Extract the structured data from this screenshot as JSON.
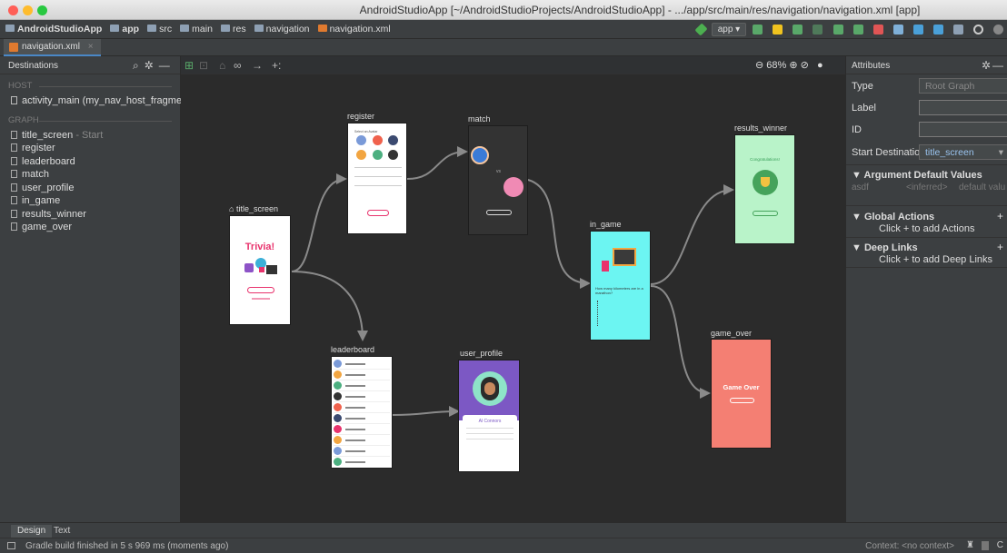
{
  "window": {
    "title": "AndroidStudioApp [~/AndroidStudioProjects/AndroidStudioApp] - .../app/src/main/res/navigation/navigation.xml [app]"
  },
  "breadcrumb": [
    "AndroidStudioApp",
    "app",
    "src",
    "main",
    "res",
    "navigation",
    "navigation.xml"
  ],
  "toolbar": {
    "run_config": "app ▾"
  },
  "editor_tab": {
    "label": "navigation.xml",
    "close": "×"
  },
  "destinations_panel": {
    "title": "Destinations",
    "host_label": "HOST",
    "host_item": "activity_main (my_nav_host_fragment)",
    "graph_label": "GRAPH",
    "items": [
      {
        "name": "title_screen",
        "suffix": " - Start"
      },
      {
        "name": "register",
        "suffix": ""
      },
      {
        "name": "leaderboard",
        "suffix": ""
      },
      {
        "name": "match",
        "suffix": ""
      },
      {
        "name": "user_profile",
        "suffix": ""
      },
      {
        "name": "in_game",
        "suffix": ""
      },
      {
        "name": "results_winner",
        "suffix": ""
      },
      {
        "name": "game_over",
        "suffix": ""
      }
    ]
  },
  "canvas": {
    "zoom": "68%",
    "labels": {
      "title_screen": "title_screen",
      "register": "register",
      "match": "match",
      "in_game": "in_game",
      "results_winner": "results_winner",
      "leaderboard": "leaderboard",
      "user_profile": "user_profile",
      "game_over": "game_over"
    },
    "title_screen_heading": "Trivia!",
    "register_heading": "Select an Avatar",
    "match_vs": "vs",
    "in_game_question": "How many kilometers are in a marathon?",
    "results_winner_text": "Congratulations!",
    "user_profile_name": "Al Connors",
    "game_over_text": "Game Over"
  },
  "attributes_panel": {
    "title": "Attributes",
    "type_label": "Type",
    "type_value": "Root Graph",
    "label_label": "Label",
    "label_value": "",
    "id_label": "ID",
    "id_value": "",
    "start_label": "Start Destinatio",
    "start_value": "title_screen",
    "arg_group": "▼ Argument Default Values",
    "arg_name": "asdf",
    "arg_type": "<inferred>",
    "arg_default": "default valu",
    "global_group": "▼ Global Actions",
    "global_hint": "Click + to add Actions",
    "deep_group": "▼ Deep Links",
    "deep_hint": "Click + to add Deep Links",
    "plus": "+"
  },
  "bottom_tabs": [
    "Design",
    "Text"
  ],
  "status": {
    "message": "Gradle build finished in 5 s 969 ms (moments ago)",
    "context": "Context: <no context>"
  },
  "colors": {
    "accent": "#4a88c7",
    "in_game_bg": "#6cf5f2",
    "results_bg": "#b9f3c9",
    "game_over_bg": "#f47f73",
    "profile_purple": "#7c58c4",
    "trivia_pink": "#e8336d"
  }
}
